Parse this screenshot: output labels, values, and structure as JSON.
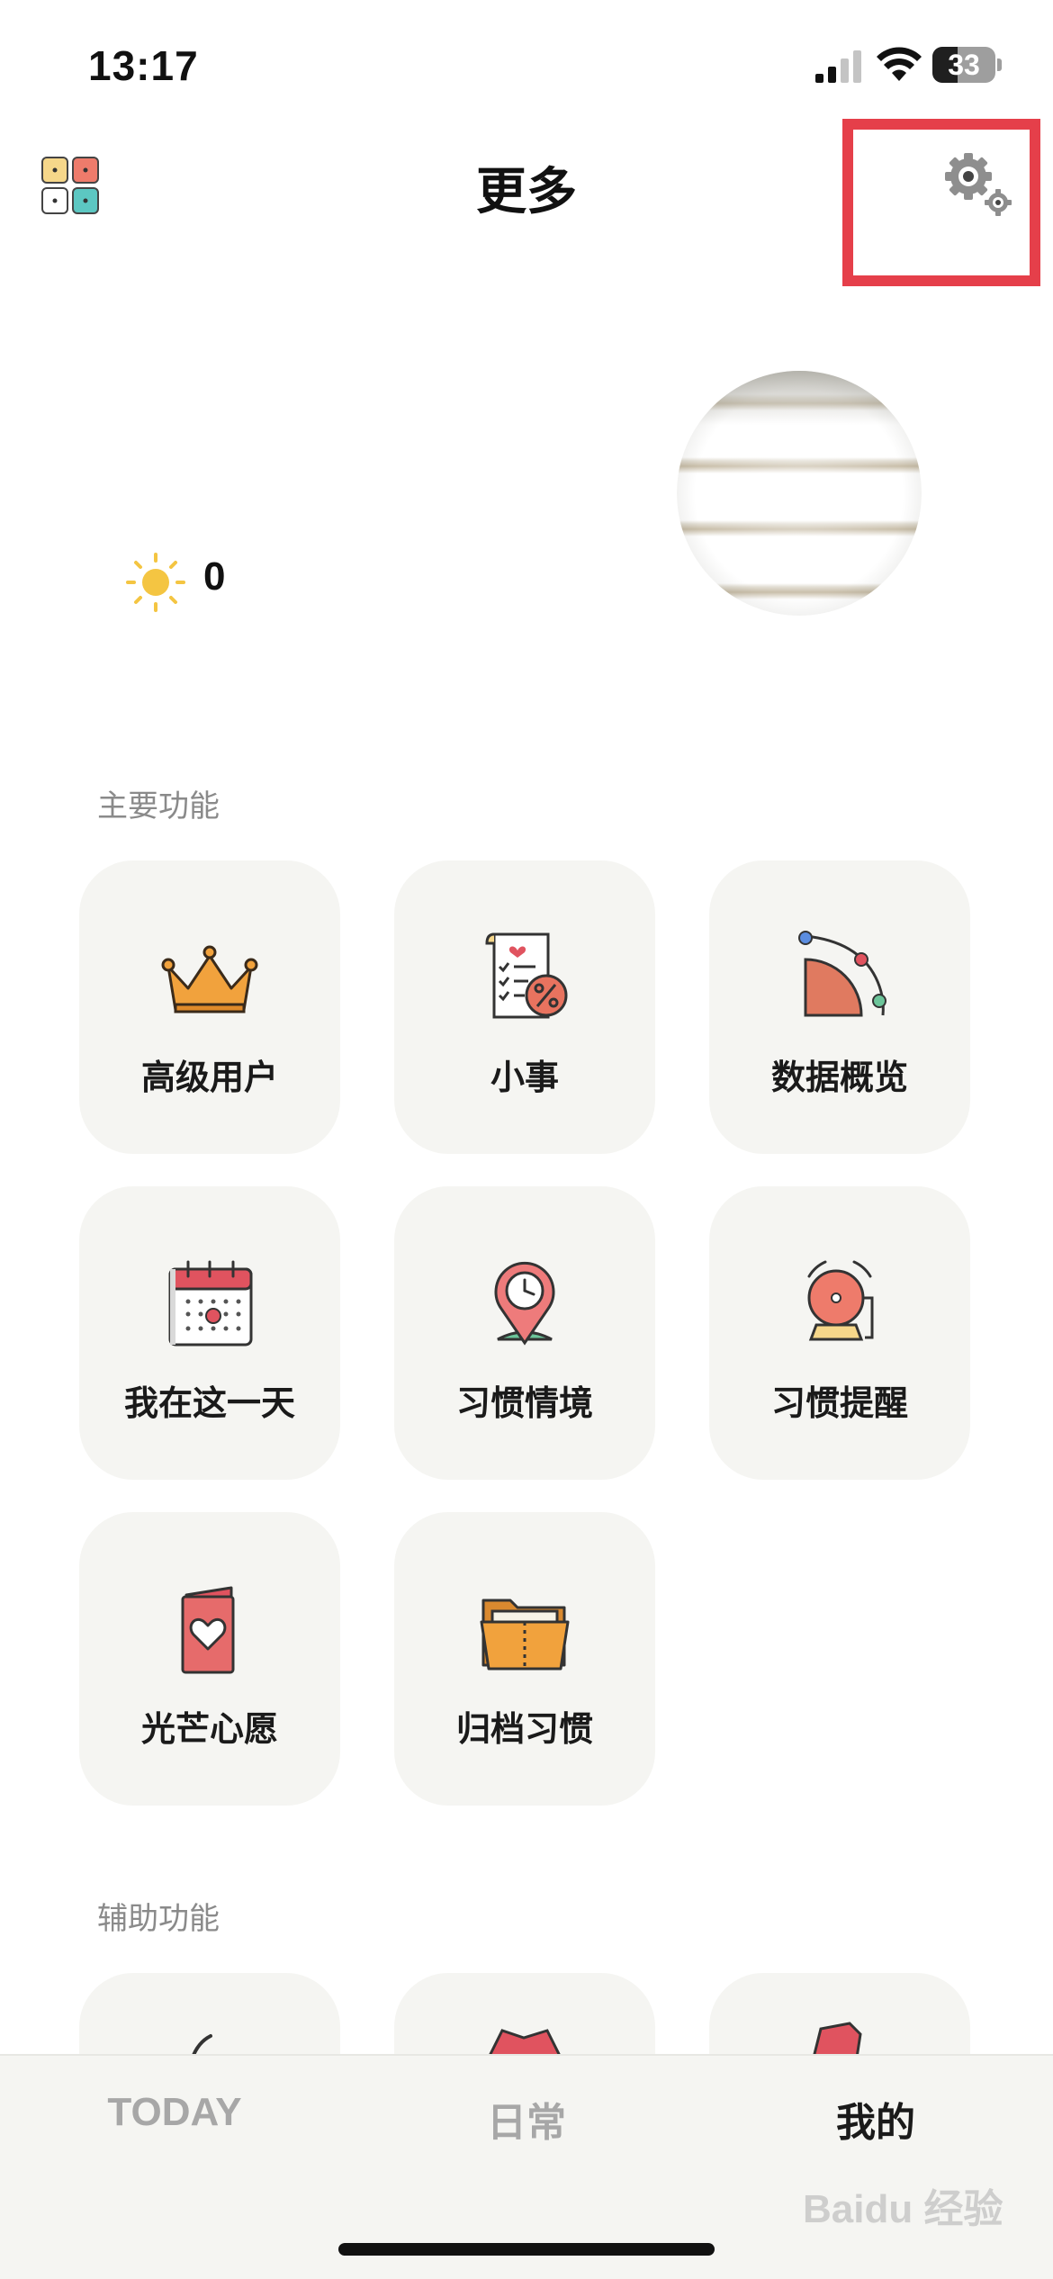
{
  "status_bar": {
    "time": "13:17",
    "battery": "33"
  },
  "header": {
    "title": "更多"
  },
  "profile": {
    "sun_count": "0"
  },
  "sections": {
    "main": {
      "label": "主要功能",
      "tiles": [
        {
          "label": "高级用户",
          "icon": "crown-icon"
        },
        {
          "label": "小事",
          "icon": "receipt-percent-icon"
        },
        {
          "label": "数据概览",
          "icon": "chart-arc-icon"
        },
        {
          "label": "我在这一天",
          "icon": "calendar-icon"
        },
        {
          "label": "习惯情境",
          "icon": "location-clock-icon"
        },
        {
          "label": "习惯提醒",
          "icon": "alarm-bell-icon"
        },
        {
          "label": "光芒心愿",
          "icon": "heart-card-icon"
        },
        {
          "label": "归档习惯",
          "icon": "folder-icon"
        }
      ]
    },
    "aux": {
      "label": "辅助功能"
    }
  },
  "tabbar": {
    "today": "TODAY",
    "daily": "日常",
    "mine": "我的"
  },
  "watermark": "Baidu 经验",
  "colors": {
    "highlight": "#e53f4a",
    "tile_bg": "#f5f5f2",
    "sun": "#f4c542"
  }
}
